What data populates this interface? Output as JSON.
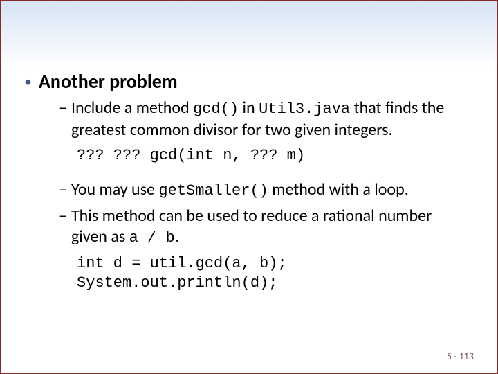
{
  "bullet1": {
    "title": "Another problem"
  },
  "sub1": {
    "prefix": "Include a method ",
    "code1": "gcd()",
    "mid1": " in ",
    "code2": "Util3.java",
    "suffix": " that finds the greatest common divisor for two given integers."
  },
  "codeblock1": {
    "line1": "??? ??? gcd(int n, ??? m)"
  },
  "sub2": {
    "prefix": "You may use ",
    "code1": "getSmaller()",
    "suffix": " method with a loop."
  },
  "sub3": {
    "prefix": "This method can be used to reduce a rational number given as ",
    "code1": "a / b",
    "suffix": "."
  },
  "codeblock2": {
    "line1": "int d = util.gcd(a, b);",
    "line2": "System.out.println(d);"
  },
  "footer": {
    "text": "5 - 113"
  }
}
